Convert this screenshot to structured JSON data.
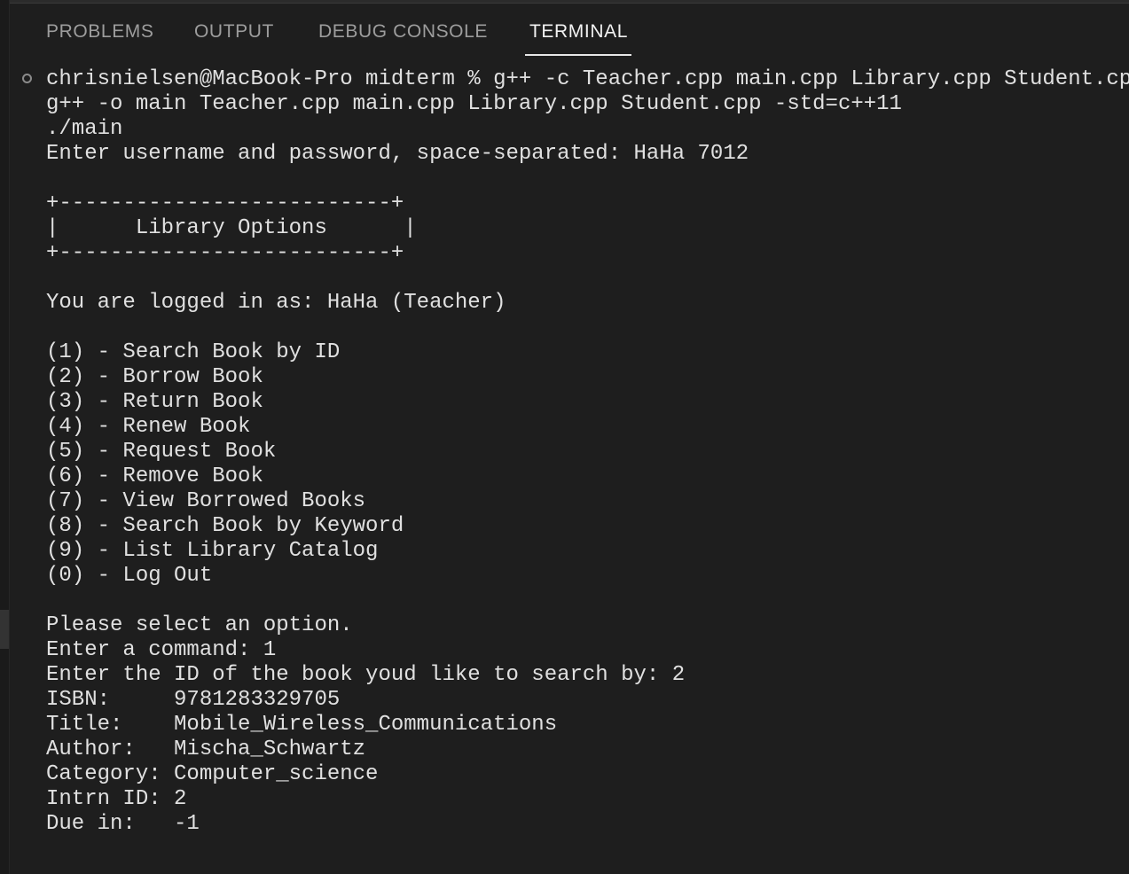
{
  "panel": {
    "tabs": [
      {
        "label": "PROBLEMS"
      },
      {
        "label": "OUTPUT"
      },
      {
        "label": "DEBUG CONSOLE"
      },
      {
        "label": "TERMINAL"
      }
    ],
    "active_tab": "TERMINAL"
  },
  "terminal": {
    "lines": [
      "chrisnielsen@MacBook-Pro midterm % g++ -c Teacher.cpp main.cpp Library.cpp Student.cpp -",
      "g++ -o main Teacher.cpp main.cpp Library.cpp Student.cpp -std=c++11",
      "./main",
      "Enter username and password, space-separated: HaHa 7012",
      "",
      "+--------------------------+",
      "|      Library Options      |",
      "+--------------------------+",
      "",
      "You are logged in as: HaHa (Teacher)",
      "",
      "(1) - Search Book by ID",
      "(2) - Borrow Book",
      "(3) - Return Book",
      "(4) - Renew Book",
      "(5) - Request Book",
      "(6) - Remove Book",
      "(7) - View Borrowed Books",
      "(8) - Search Book by Keyword",
      "(9) - List Library Catalog",
      "(0) - Log Out",
      "",
      "Please select an option.",
      "Enter a command: 1",
      "Enter the ID of the book youd like to search by: 2",
      "ISBN:     9781283329705",
      "Title:    Mobile_Wireless_Communications",
      "Author:   Mischa_Schwartz",
      "Category: Computer_science",
      "Intrn ID: 2",
      "Due in:   -1"
    ]
  }
}
